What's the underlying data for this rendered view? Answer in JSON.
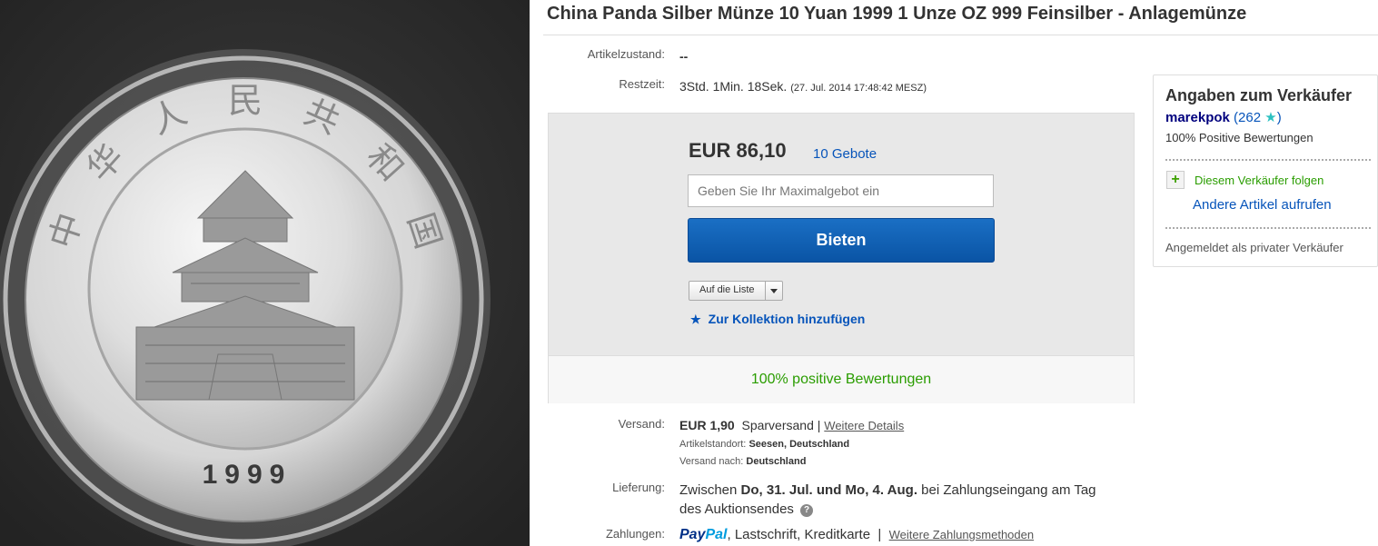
{
  "listing": {
    "title": "China Panda Silber Münze 10 Yuan 1999 1 Unze OZ 999 Feinsilber - Anlagemünze",
    "coin_chinese_text": "中华人民共和国",
    "coin_year": "1999"
  },
  "details": {
    "condition_label": "Artikelzustand:",
    "condition_value": "--",
    "remaining_label": "Restzeit:",
    "remaining_value": "3Std. 1Min. 18Sek.",
    "remaining_end": "(27. Jul. 2014   17:48:42 MESZ)"
  },
  "bid": {
    "price": "EUR 86,10",
    "bid_count": "10 Gebote",
    "max_bid_placeholder": "Geben Sie Ihr Maximalgebot ein",
    "bid_button": "Bieten",
    "watch_label": "Auf die Liste",
    "collection_label": "Zur Kollektion hinzufügen",
    "positive_feedback": "100% positive Bewertungen"
  },
  "shipping": {
    "label": "Versand:",
    "price": "EUR 1,90",
    "method": "Sparversand",
    "separator": "|",
    "details_link": "Weitere Details",
    "location_label": "Artikelstandort:",
    "location_value": "Seesen, Deutschland",
    "ships_to_label": "Versand nach:",
    "ships_to_value": "Deutschland"
  },
  "delivery": {
    "label": "Lieferung:",
    "prefix": "Zwischen",
    "dates": "Do, 31. Jul. und Mo, 4. Aug.",
    "suffix_line1": "bei Zahlungseingang am Tag",
    "suffix_line2": "des Auktionsendes",
    "help_icon": "?"
  },
  "payment": {
    "label": "Zahlungen:",
    "paypal_a": "Pay",
    "paypal_b": "Pal",
    "methods": ", Lastschrift, Kreditkarte",
    "separator": "|",
    "more_link": "Weitere Zahlungsmethoden"
  },
  "seller": {
    "heading": "Angaben zum Verkäufer",
    "name": "marekpok",
    "open_paren": "(",
    "score": "262",
    "close_paren": ")",
    "positive": "100% Positive Bewertungen",
    "follow": "Diesem Verkäufer folgen",
    "other_items": "Andere Artikel aufrufen",
    "seller_type": "Angemeldet als privater Verkäufer"
  },
  "colors": {
    "link_blue": "#0654ba",
    "green": "#2a9d00",
    "bid_button": "#0a54a5"
  }
}
